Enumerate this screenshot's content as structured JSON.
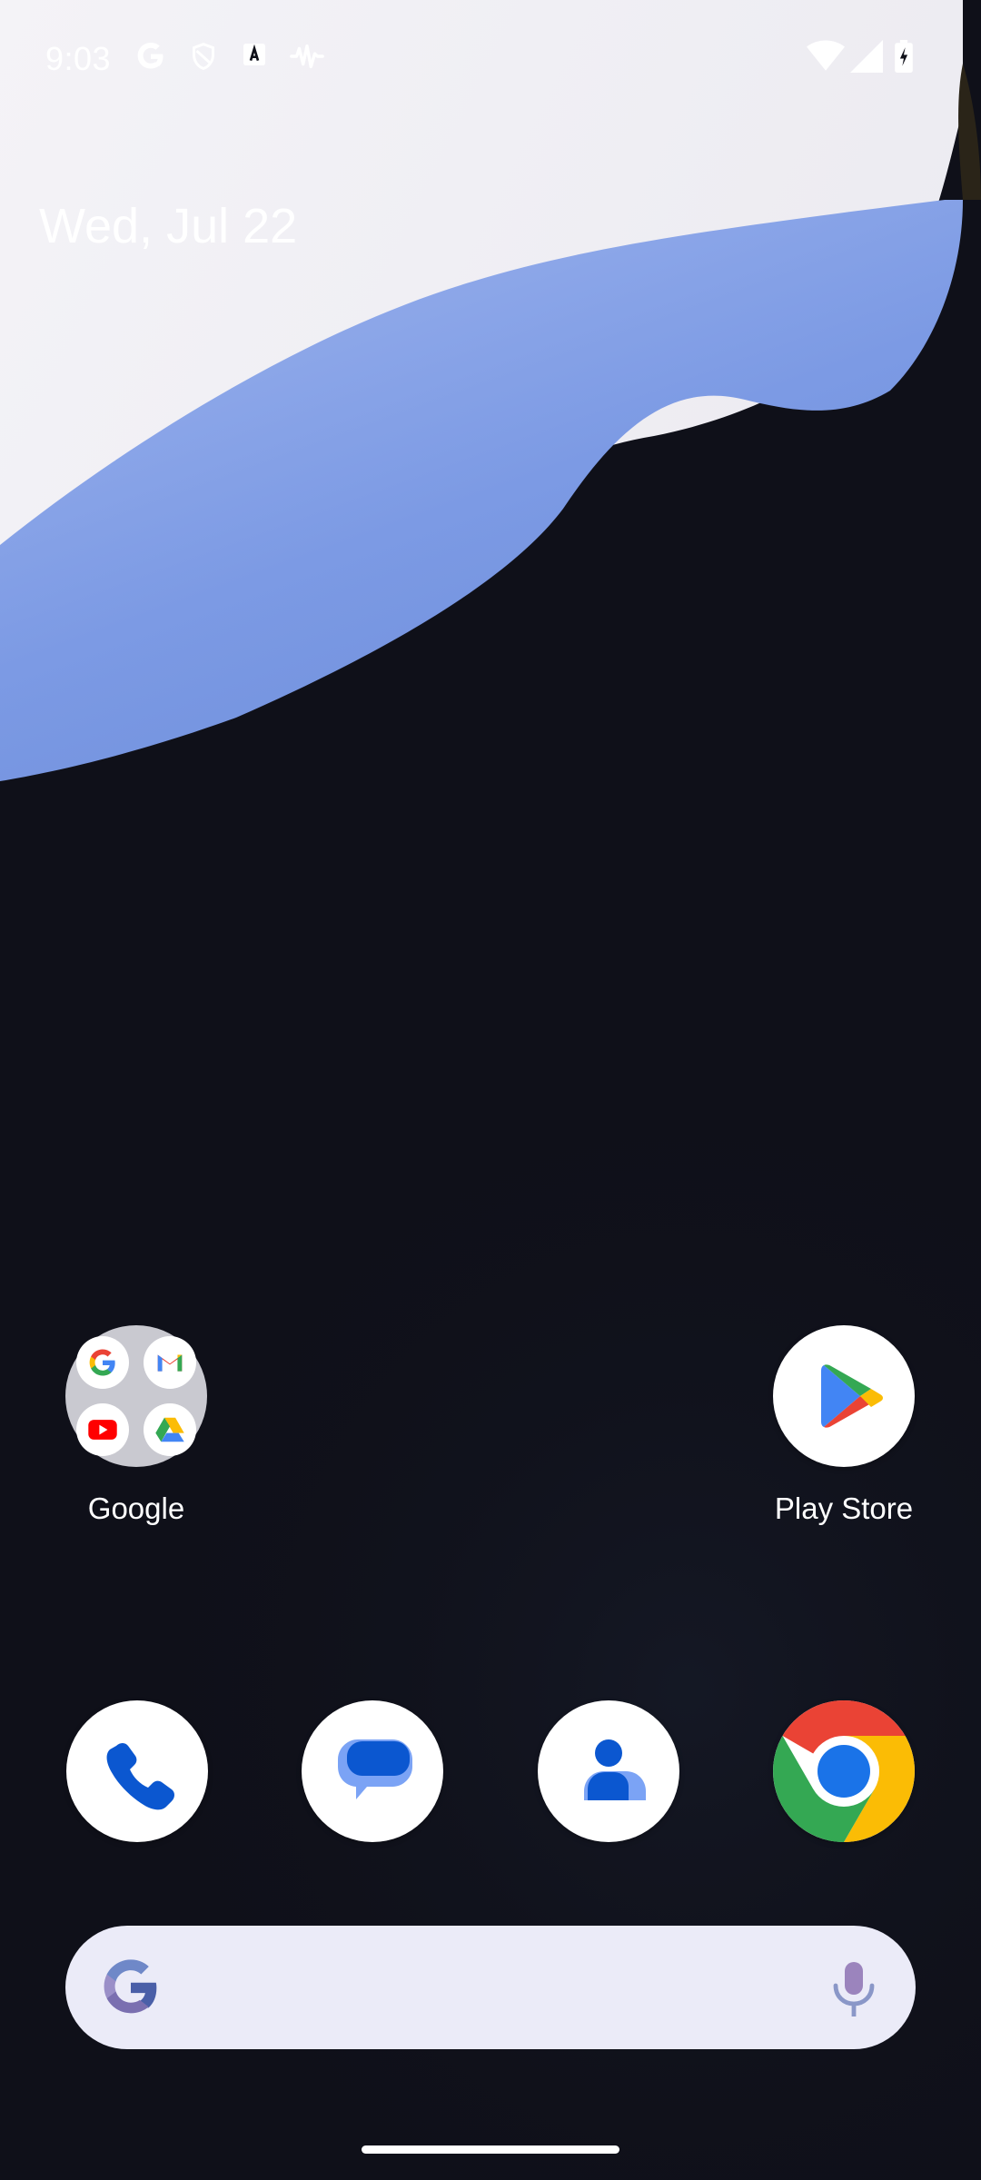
{
  "status_bar": {
    "time": "9:03",
    "left_icons": [
      "google-icon",
      "shield-icon",
      "text-a-icon",
      "waveform-icon"
    ],
    "right_icons": [
      "wifi-icon",
      "signal-icon",
      "battery-charging-icon"
    ]
  },
  "date_widget": {
    "text": "Wed, Jul 22"
  },
  "home": {
    "folder": {
      "label": "Google",
      "apps": [
        "google-g-icon",
        "gmail-icon",
        "youtube-icon",
        "drive-icon"
      ]
    },
    "shortcut": {
      "label": "Play Store",
      "icon": "play-store-icon"
    }
  },
  "dock": {
    "apps": [
      {
        "name": "phone",
        "icon": "phone-icon"
      },
      {
        "name": "messages",
        "icon": "messages-icon"
      },
      {
        "name": "contacts",
        "icon": "contacts-icon"
      },
      {
        "name": "chrome",
        "icon": "chrome-icon"
      }
    ]
  },
  "search_bar": {
    "left_icon": "google-g-icon",
    "right_icon": "mic-icon"
  },
  "colors": {
    "wallpaper_dark": "#0f1019",
    "wallpaper_blue": "#7fa0e6",
    "google_blue": "#4285F4",
    "google_red": "#EA4335",
    "google_yellow": "#FBBC05",
    "google_green": "#34A853",
    "search_bg": "#ebebf8"
  }
}
